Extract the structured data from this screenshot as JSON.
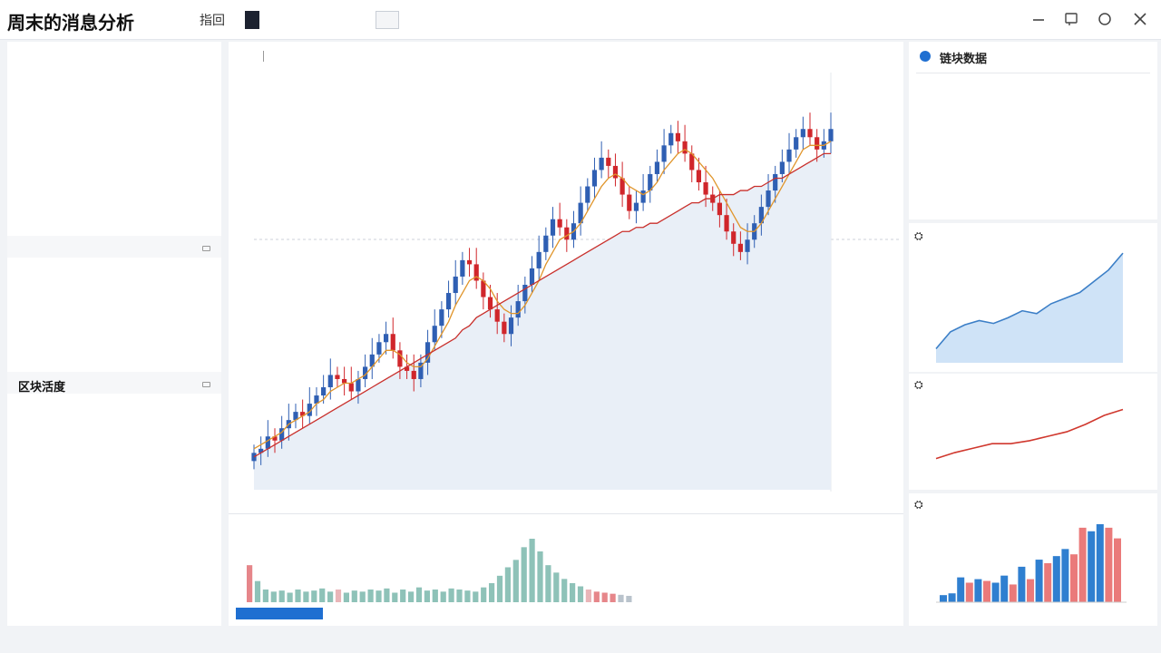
{
  "header": {
    "title": "周末的消息分析",
    "tabs": [
      {
        "label": "",
        "state": "normal"
      },
      {
        "label": "指回",
        "state": "normal"
      },
      {
        "label": "",
        "state": "active"
      },
      {
        "label": "",
        "state": "normal"
      },
      {
        "label": "",
        "state": "ghost"
      }
    ]
  },
  "left": {
    "sec1": {
      "title": "",
      "value": "",
      "rows": [
        {
          "name": "",
          "v1": "",
          "v2": ""
        },
        {
          "name": "",
          "v1": "",
          "v2": "",
          "d": "up"
        },
        {
          "name": "",
          "v1": "",
          "v2": "",
          "d": "up"
        },
        {
          "name": "",
          "v1": "",
          "v2": "",
          "d": "up"
        },
        {
          "name": "",
          "v1": "",
          "v2": "",
          "d": "up"
        },
        {
          "name": "",
          "v1": "",
          "v2": "",
          "d": "up"
        },
        {
          "name": "",
          "v1": "",
          "v2": "",
          "d": "up"
        },
        {
          "name": "",
          "v1": "",
          "v2": "",
          "d": "up"
        },
        {
          "name": "",
          "v1": "",
          "v2": "",
          "d": "up"
        }
      ]
    },
    "sec2": {
      "title": "",
      "rows": [
        {
          "name": "",
          "v1": "",
          "v2": "",
          "d": "up"
        },
        {
          "name": "",
          "v1": "",
          "v2": "",
          "d": "up"
        },
        {
          "name": "",
          "v1": "",
          "v2": "",
          "d": "up"
        },
        {
          "name": "",
          "v1": "",
          "v2": "",
          "d": "up"
        },
        {
          "name": "",
          "v1": "",
          "v2": "",
          "d": "up"
        },
        {
          "name": "",
          "v1": "",
          "v2": "",
          "d": "blue"
        }
      ]
    },
    "sec3": {
      "title": "区块活度",
      "rows": [
        {
          "name": "",
          "v1": "",
          "v2": "",
          "d": "up"
        },
        {
          "name": "",
          "v1": "",
          "v2": "",
          "d": "up"
        },
        {
          "name": "",
          "v1": "",
          "v2": "",
          "d": "up"
        },
        {
          "name": "",
          "v1": "",
          "v2": "",
          "d": "up"
        },
        {
          "name": "",
          "v1": "",
          "v2": "",
          "d": "up"
        },
        {
          "name": "",
          "v1": "",
          "v2": "",
          "d": "up"
        },
        {
          "name": "",
          "v1": "",
          "v2": "",
          "d": "up"
        },
        {
          "name": "",
          "v1": "",
          "v2": "",
          "d": "dn"
        },
        {
          "name": "",
          "v1": "",
          "v2": "",
          "d": "dn"
        },
        {
          "name": "",
          "v1": "",
          "v2": "",
          "d": "up"
        },
        {
          "name": "",
          "v1": "",
          "v2": "",
          "d": "dn"
        },
        {
          "name": "",
          "v1": "",
          "v2": "",
          "d": "dn"
        }
      ]
    }
  },
  "toolbar": {
    "items": [
      "",
      "",
      "",
      "",
      "",
      "",
      "",
      ""
    ]
  },
  "status_text": "",
  "chart_data": [
    {
      "type": "candlestick",
      "title": "",
      "ylabel_ticks": [
        "",
        "",
        "",
        "",
        "",
        "",
        "",
        "",
        ""
      ],
      "x_ticks": [
        "",
        "",
        "",
        "",
        "",
        "",
        "",
        "",
        "",
        "",
        "",
        "",
        ""
      ],
      "top_right": [
        "",
        "",
        ""
      ],
      "peak_label": "",
      "bottom_right": "",
      "bottom_left_note": "",
      "ylim": [
        0,
        100
      ],
      "closes": [
        9,
        10,
        13,
        12,
        15,
        17,
        19,
        18,
        21,
        23,
        25,
        28,
        27,
        26,
        24,
        27,
        30,
        33,
        36,
        38,
        34,
        30,
        29,
        27,
        31,
        36,
        40,
        44,
        48,
        52,
        56,
        55,
        51,
        47,
        44,
        41,
        38,
        42,
        46,
        50,
        54,
        58,
        62,
        66,
        64,
        61,
        65,
        70,
        74,
        78,
        81,
        79,
        76,
        72,
        68,
        70,
        73,
        77,
        80,
        84,
        87,
        85,
        82,
        78,
        75,
        72,
        70,
        67,
        63,
        60,
        58,
        61,
        65,
        69,
        73,
        77,
        80,
        83,
        86,
        88,
        86,
        83,
        85,
        88
      ],
      "ma_short": [
        10,
        11,
        12,
        13,
        14,
        16,
        17,
        18,
        19,
        21,
        22,
        24,
        25,
        26,
        26,
        27,
        28,
        30,
        32,
        34,
        34,
        33,
        31,
        30,
        30,
        32,
        35,
        38,
        41,
        45,
        48,
        51,
        52,
        51,
        49,
        46,
        44,
        43,
        43,
        45,
        48,
        51,
        55,
        58,
        61,
        62,
        63,
        65,
        68,
        71,
        74,
        76,
        77,
        76,
        74,
        73,
        72,
        73,
        75,
        78,
        80,
        82,
        83,
        82,
        80,
        78,
        76,
        73,
        70,
        67,
        64,
        63,
        63,
        65,
        68,
        71,
        74,
        77,
        80,
        83,
        84,
        84,
        84,
        85
      ],
      "ma_long": [
        8,
        9,
        10,
        11,
        12,
        13,
        14,
        15,
        16,
        17,
        18,
        19,
        20,
        21,
        22,
        23,
        24,
        25,
        26,
        27,
        28,
        29,
        30,
        31,
        32,
        33,
        34,
        35,
        36,
        37,
        39,
        40,
        42,
        43,
        44,
        45,
        46,
        47,
        48,
        49,
        50,
        51,
        52,
        53,
        54,
        55,
        56,
        57,
        58,
        59,
        60,
        61,
        62,
        63,
        63,
        64,
        64,
        65,
        65,
        66,
        67,
        68,
        69,
        70,
        70,
        71,
        71,
        72,
        72,
        72,
        73,
        73,
        74,
        74,
        75,
        76,
        76,
        77,
        78,
        79,
        80,
        81,
        82,
        82
      ]
    },
    {
      "type": "bar",
      "title": "",
      "right_label": "",
      "footer_right": "",
      "button_label": "",
      "values": [
        35,
        20,
        12,
        10,
        11,
        9,
        12,
        10,
        11,
        13,
        10,
        12,
        9,
        11,
        10,
        12,
        11,
        13,
        9,
        12,
        10,
        14,
        11,
        12,
        10,
        13,
        12,
        11,
        10,
        14,
        18,
        25,
        33,
        40,
        52,
        60,
        48,
        35,
        28,
        22,
        18,
        15,
        12,
        10,
        9,
        8,
        7,
        6
      ],
      "colors": [
        "r",
        "t",
        "t",
        "t",
        "t",
        "t",
        "t",
        "t",
        "t",
        "t",
        "t",
        "p",
        "t",
        "t",
        "t",
        "t",
        "t",
        "t",
        "t",
        "t",
        "t",
        "t",
        "t",
        "t",
        "t",
        "t",
        "t",
        "t",
        "t",
        "t",
        "t",
        "t",
        "t",
        "t",
        "t",
        "t",
        "t",
        "t",
        "t",
        "t",
        "t",
        "t",
        "p",
        "r",
        "r",
        "r",
        "g",
        "g"
      ]
    }
  ],
  "right": {
    "panel_title": "链块数据",
    "panel_meta": "",
    "table": [
      {
        "idx": "",
        "name": "",
        "a": "",
        "b": "",
        "c": ""
      },
      {
        "idx": "",
        "name": "",
        "a": "",
        "b": "",
        "c": ""
      },
      {
        "idx": "",
        "name": "",
        "a": "",
        "b": "",
        "c": ""
      },
      {
        "idx": "",
        "name": "",
        "a": "",
        "b": "",
        "c": ""
      },
      {
        "idx": "",
        "name": "",
        "a": "",
        "b": "",
        "c": ""
      },
      {
        "idx": "",
        "name": "",
        "a": "",
        "b": "",
        "c": ""
      }
    ],
    "area_chart": {
      "title": "",
      "yticks": [
        "",
        "",
        "",
        "",
        "",
        ""
      ],
      "right_ticks": [
        "",
        "",
        "",
        "",
        "",
        "",
        ""
      ],
      "values": [
        10,
        22,
        27,
        30,
        28,
        32,
        37,
        35,
        42,
        46,
        50,
        58,
        66,
        78
      ]
    },
    "line_chart": {
      "title": "",
      "yticks": [
        "",
        "",
        "",
        "",
        "",
        ""
      ],
      "right_ticks": [
        "",
        "",
        "",
        ""
      ],
      "xticks": [
        "",
        "",
        ""
      ],
      "values": [
        10,
        14,
        17,
        20,
        20,
        22,
        25,
        28,
        33,
        39,
        43
      ]
    },
    "bar_chart": {
      "title": "",
      "yticks": [
        "",
        "",
        "",
        ""
      ],
      "right_ticks": [
        "",
        "",
        "",
        ""
      ],
      "x_first": "",
      "values": [
        8,
        10,
        28,
        22,
        26,
        24,
        22,
        30,
        20,
        40,
        26,
        48,
        44,
        52,
        60,
        54,
        84,
        80,
        88,
        84,
        72
      ],
      "colors": [
        "b",
        "b",
        "b",
        "r",
        "b",
        "r",
        "b",
        "b",
        "r",
        "b",
        "r",
        "b",
        "r",
        "b",
        "b",
        "r",
        "r",
        "b",
        "b",
        "r",
        "r"
      ]
    }
  },
  "colors": {
    "up": "#1f9a3a",
    "down": "#d12c2c",
    "candle_up": "#2f5fb3",
    "candle_down": "#d0262b",
    "accent": "#1f6fd1"
  }
}
